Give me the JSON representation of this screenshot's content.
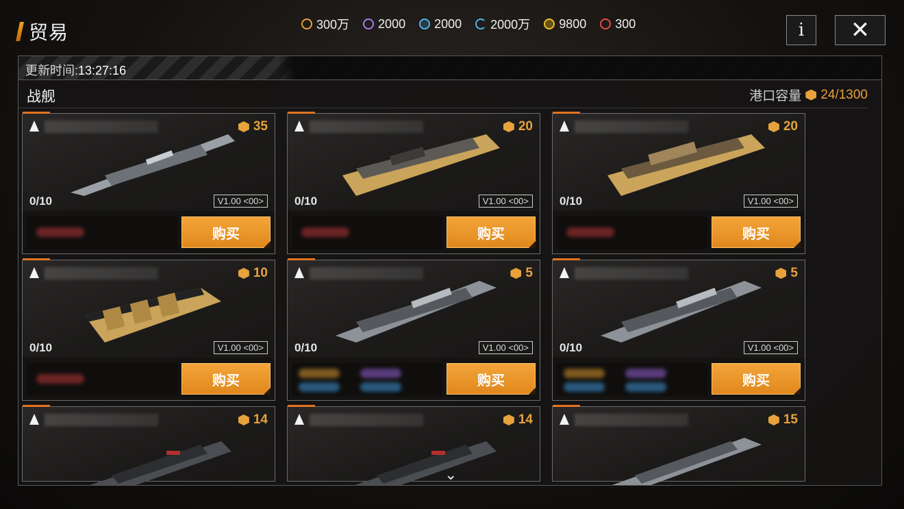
{
  "header": {
    "title": "贸易",
    "resources": [
      {
        "icon": "triangle-coin-icon",
        "value": "300万",
        "color": "#e8a23c"
      },
      {
        "icon": "purple-gem-icon",
        "value": "2000",
        "color": "#a77df0"
      },
      {
        "icon": "blue-crystal-icon",
        "value": "2000",
        "color": "#4fb6ea"
      },
      {
        "icon": "cyan-refresh-icon",
        "value": "2000万",
        "color": "#4fb6ea"
      },
      {
        "icon": "gold-badge-icon",
        "value": "9800",
        "color": "#f0c020"
      },
      {
        "icon": "red-token-icon",
        "value": "300",
        "color": "#e84a4a"
      }
    ],
    "info_label": "i",
    "close_label": "✕"
  },
  "update": {
    "label": "更新时间:",
    "time": "13:27:16"
  },
  "section": {
    "title": "战舰",
    "capacity_label": "港口容量",
    "capacity_value": "24/1300"
  },
  "cards": [
    {
      "cost": "35",
      "stock": "0/10",
      "version": "V1.00 <00>",
      "buy": "购买"
    },
    {
      "cost": "20",
      "stock": "0/10",
      "version": "V1.00 <00>",
      "buy": "购买"
    },
    {
      "cost": "20",
      "stock": "0/10",
      "version": "V1.00 <00>",
      "buy": "购买"
    },
    {
      "cost": "10",
      "stock": "0/10",
      "version": "V1.00 <00>",
      "buy": "购买"
    },
    {
      "cost": "5",
      "stock": "0/10",
      "version": "V1.00 <00>",
      "buy": "购买"
    },
    {
      "cost": "5",
      "stock": "0/10",
      "version": "V1.00 <00>",
      "buy": "购买"
    },
    {
      "cost": "14"
    },
    {
      "cost": "14"
    },
    {
      "cost": "15"
    }
  ],
  "scroll_hint": "⌄"
}
